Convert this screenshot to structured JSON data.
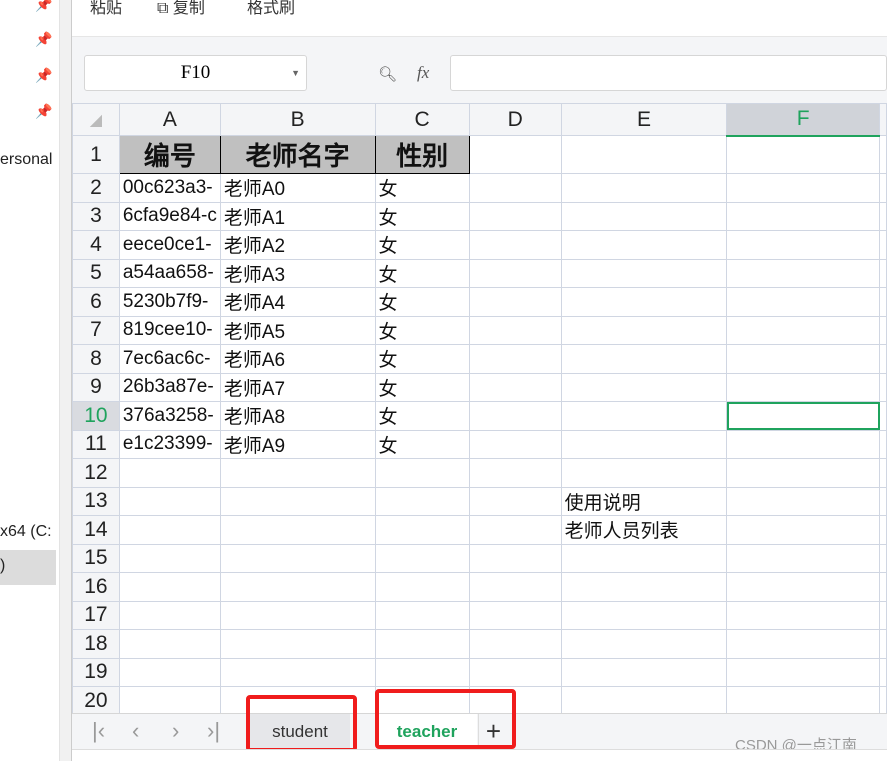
{
  "sidebar": {
    "items": [
      {
        "label": "ersonal"
      },
      {
        "label": "x64 (C:"
      },
      {
        "label": ")"
      }
    ],
    "pin_icon": "pin-icon"
  },
  "ribbon": {
    "paste": "粘贴",
    "copy": "复制",
    "format_painter": "格式刷"
  },
  "formula_bar": {
    "name_box": "F10",
    "fx": "fx",
    "value": ""
  },
  "columns": [
    "A",
    "B",
    "C",
    "D",
    "E",
    "F"
  ],
  "selected": {
    "row": 10,
    "col": "F"
  },
  "accent": "#1fa35d",
  "rows": [
    [
      "编号",
      "老师名字",
      "性别",
      "",
      "",
      ""
    ],
    [
      "00c623a3-",
      "老师A0",
      "女",
      "",
      "",
      ""
    ],
    [
      "6cfa9e84-c",
      "老师A1",
      "女",
      "",
      "",
      ""
    ],
    [
      "eece0ce1-",
      "老师A2",
      "女",
      "",
      "",
      ""
    ],
    [
      "a54aa658-",
      "老师A3",
      "女",
      "",
      "",
      ""
    ],
    [
      "5230b7f9-",
      "老师A4",
      "女",
      "",
      "",
      ""
    ],
    [
      "819cee10-",
      "老师A5",
      "女",
      "",
      "",
      ""
    ],
    [
      "7ec6ac6c-",
      "老师A6",
      "女",
      "",
      "",
      ""
    ],
    [
      "26b3a87e-",
      "老师A7",
      "女",
      "",
      "",
      ""
    ],
    [
      "376a3258-",
      "老师A8",
      "女",
      "",
      "",
      ""
    ],
    [
      "e1c23399-",
      "老师A9",
      "女",
      "",
      "",
      ""
    ],
    [
      "",
      "",
      "",
      "",
      "",
      ""
    ],
    [
      "",
      "",
      "",
      "",
      "使用说明",
      ""
    ],
    [
      "",
      "",
      "",
      "",
      "老师人员列表",
      ""
    ],
    [
      "",
      "",
      "",
      "",
      "",
      ""
    ],
    [
      "",
      "",
      "",
      "",
      "",
      ""
    ],
    [
      "",
      "",
      "",
      "",
      "",
      ""
    ],
    [
      "",
      "",
      "",
      "",
      "",
      ""
    ],
    [
      "",
      "",
      "",
      "",
      "",
      ""
    ],
    [
      "",
      "",
      "",
      "",
      "",
      ""
    ]
  ],
  "sheets": [
    {
      "label": "student",
      "active": false
    },
    {
      "label": "teacher",
      "active": true
    }
  ],
  "add_sheet": "+",
  "watermark": "CSDN @一点江南"
}
